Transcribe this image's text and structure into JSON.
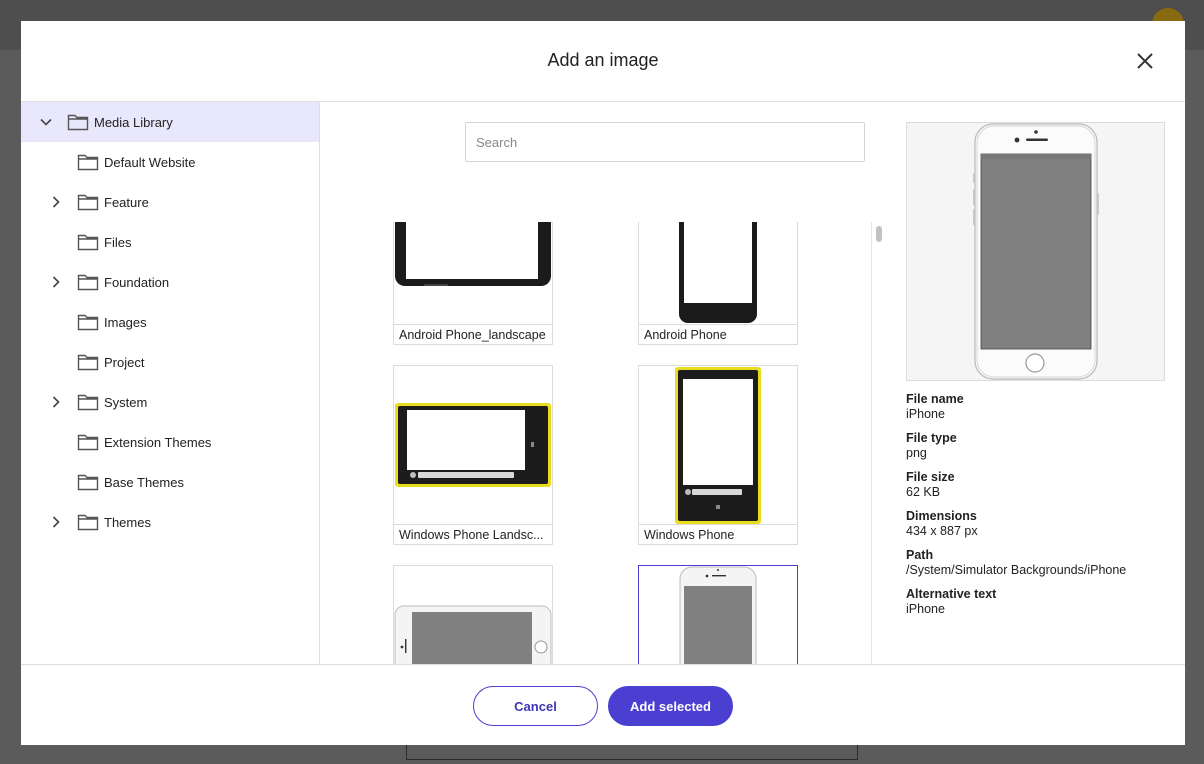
{
  "dialog": {
    "title": "Add an image",
    "close_icon": "close-icon"
  },
  "sidebar": {
    "items": [
      {
        "label": "Media Library",
        "expandable": true,
        "expanded": true,
        "selected": true,
        "level": 0
      },
      {
        "label": "Default Website",
        "expandable": false,
        "level": 1
      },
      {
        "label": "Feature",
        "expandable": true,
        "expanded": false,
        "level": 1
      },
      {
        "label": "Files",
        "expandable": false,
        "level": 1
      },
      {
        "label": "Foundation",
        "expandable": true,
        "expanded": false,
        "level": 1
      },
      {
        "label": "Images",
        "expandable": false,
        "level": 1
      },
      {
        "label": "Project",
        "expandable": false,
        "level": 1
      },
      {
        "label": "System",
        "expandable": true,
        "expanded": false,
        "level": 1
      },
      {
        "label": "Extension Themes",
        "expandable": false,
        "level": 1
      },
      {
        "label": "Base Themes",
        "expandable": false,
        "level": 1
      },
      {
        "label": "Themes",
        "expandable": true,
        "expanded": false,
        "level": 1
      }
    ]
  },
  "search": {
    "placeholder": "Search",
    "value": ""
  },
  "grid": {
    "items": [
      {
        "caption": "Android Phone_landscape"
      },
      {
        "caption": "Android Phone"
      },
      {
        "caption": "Windows Phone Landsc..."
      },
      {
        "caption": "Windows Phone"
      },
      {
        "caption": ""
      },
      {
        "caption": "",
        "selected": true
      }
    ]
  },
  "details": {
    "file_name_label": "File name",
    "file_name": "iPhone",
    "file_type_label": "File type",
    "file_type": "png",
    "file_size_label": "File size",
    "file_size": "62 KB",
    "dimensions_label": "Dimensions",
    "dimensions": "434 x 887 px",
    "path_label": "Path",
    "path": "/System/Simulator Backgrounds/iPhone",
    "alt_label": "Alternative text",
    "alt": "iPhone"
  },
  "footer": {
    "cancel_label": "Cancel",
    "add_label": "Add selected"
  },
  "colors": {
    "accent": "#4b3fd1",
    "selected_bg": "#e9e7fb",
    "windows_phone_yellow": "#e8dc1c",
    "screen_gray": "#808080"
  }
}
